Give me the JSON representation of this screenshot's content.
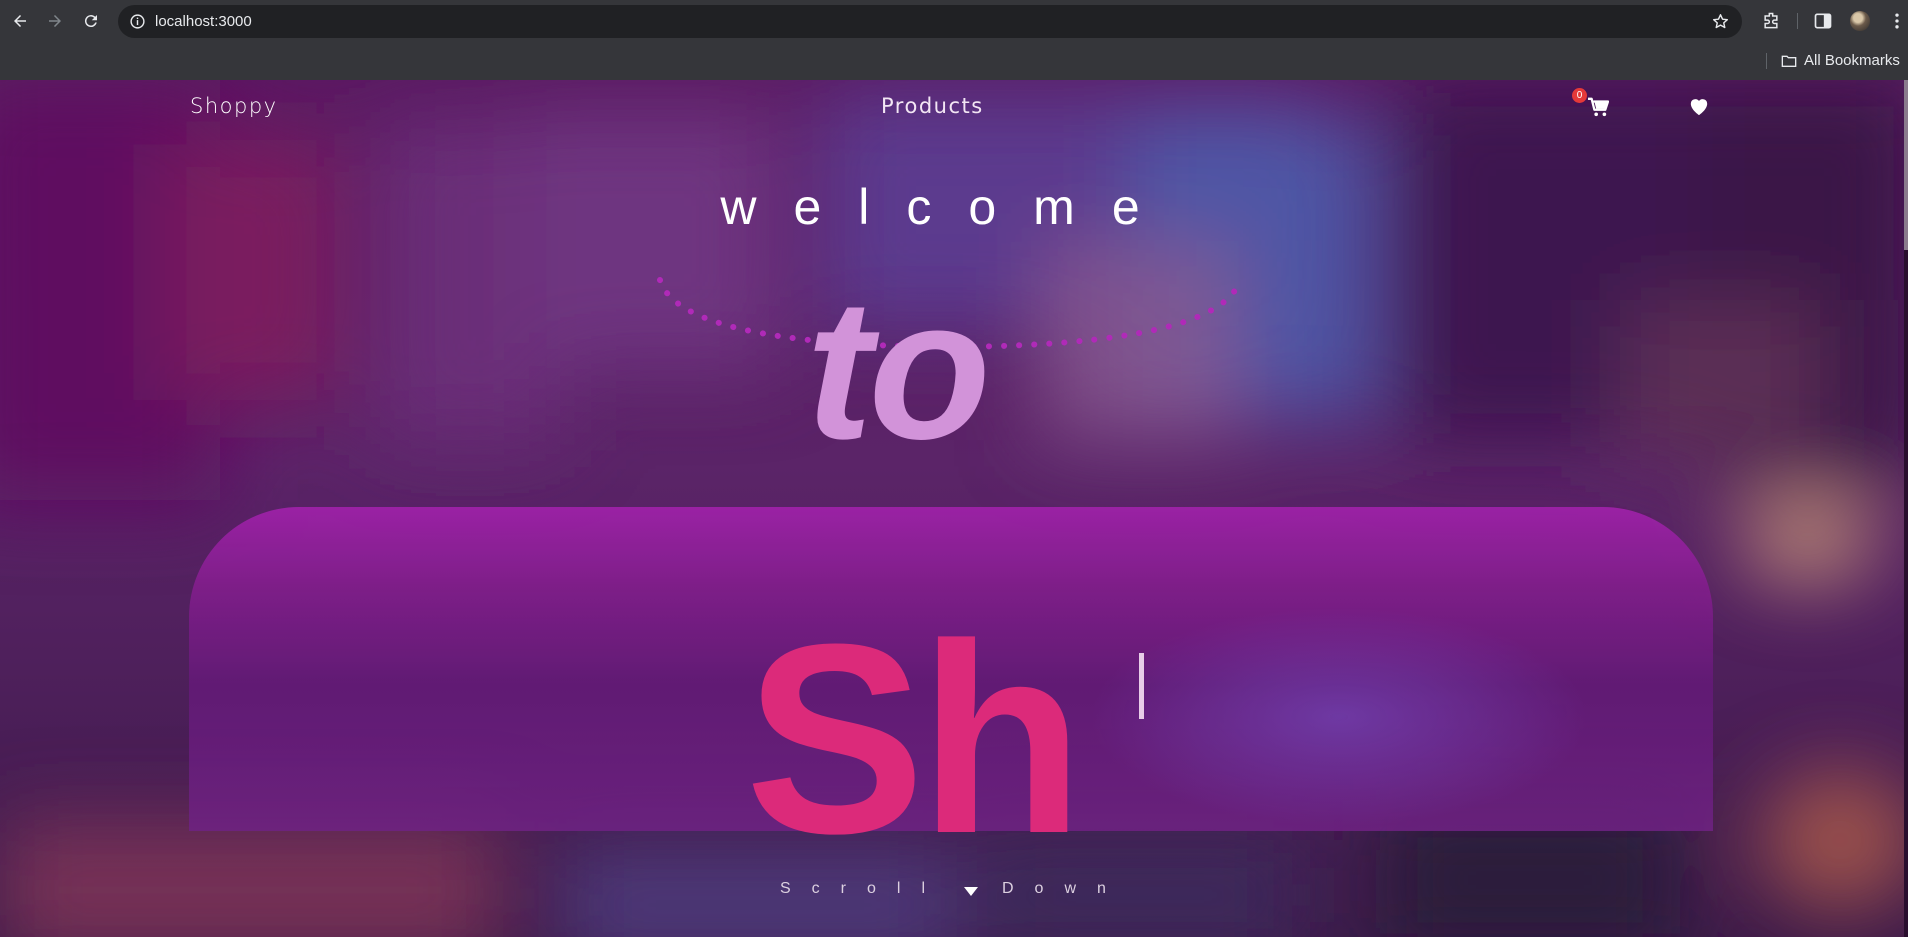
{
  "browser": {
    "url": "localhost:3000",
    "bookmarks_label": "All Bookmarks"
  },
  "site": {
    "brand": "Shoppy",
    "nav_products": "Products",
    "cart_count": "0"
  },
  "hero": {
    "welcome": "welcome",
    "to": "to",
    "typed": "Sh",
    "scroll_left": "Scroll",
    "scroll_right": "Down"
  },
  "colors": {
    "accent_pink": "#dc2a7a",
    "to_color": "#d293d9",
    "panel": "#a022aa",
    "badge": "#e53939"
  },
  "icons": [
    "back-arrow-icon",
    "forward-arrow-icon",
    "reload-icon",
    "site-info-icon",
    "star-icon",
    "extensions-icon",
    "side-panel-icon",
    "menu-icon",
    "folder-icon",
    "cart-icon",
    "heart-icon",
    "chevron-down-icon"
  ]
}
